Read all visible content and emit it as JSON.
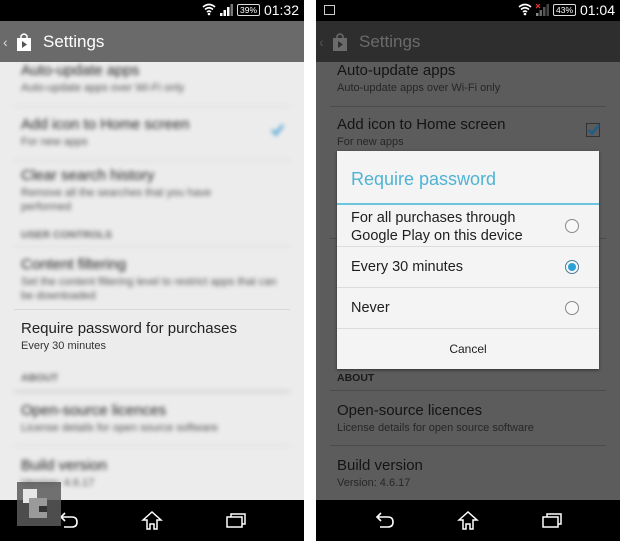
{
  "left": {
    "status": {
      "time": "01:32",
      "battery": "39%"
    },
    "actionbar": {
      "title": "Settings"
    },
    "prefs": {
      "auto_update": {
        "title": "Auto-update apps",
        "summary": "Auto-update apps over Wi-Fi only"
      },
      "add_icon": {
        "title": "Add icon to Home screen",
        "summary": "For new apps",
        "checked": true
      },
      "clear_history": {
        "title": "Clear search history",
        "summary": "Remove all the searches that you have performed"
      },
      "user_controls": "USER CONTROLS",
      "content_filtering": {
        "title": "Content filtering",
        "summary": "Set the content filtering level to restrict apps that can be downloaded"
      },
      "require_password": {
        "title": "Require password for purchases",
        "summary": "Every 30 minutes"
      },
      "about": "ABOUT",
      "licences": {
        "title": "Open-source licences",
        "summary": "License details for open source software"
      },
      "build": {
        "title": "Build version",
        "summary": "Version: 4.6.17"
      }
    }
  },
  "right": {
    "status": {
      "time": "01:04",
      "battery": "43%"
    },
    "actionbar": {
      "title": "Settings"
    },
    "prefs": {
      "auto_update": {
        "title": "Auto-update apps",
        "summary": "Auto-update apps over Wi-Fi only"
      },
      "add_icon": {
        "title": "Add icon to Home screen",
        "summary": "For new apps",
        "checked": true
      },
      "about": "ABOUT",
      "licences": {
        "title": "Open-source licences",
        "summary": "License details for open source software"
      },
      "build": {
        "title": "Build version",
        "summary": "Version: 4.6.17"
      }
    },
    "dialog": {
      "title": "Require password",
      "options": [
        {
          "label": "For all purchases through Google Play on this device",
          "selected": false
        },
        {
          "label": "Every 30 minutes",
          "selected": true
        },
        {
          "label": "Never",
          "selected": false
        }
      ],
      "cancel": "Cancel"
    }
  },
  "colors": {
    "accent": "#4fb3d3",
    "radio_selected": "#2aa0d6"
  }
}
